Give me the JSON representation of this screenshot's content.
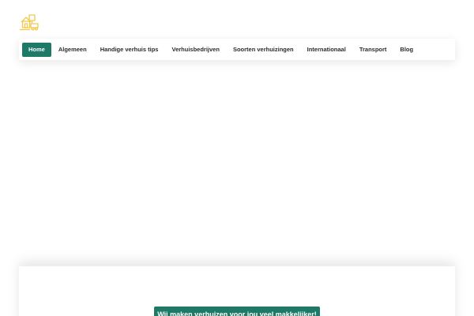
{
  "logo": {
    "icon": "house-moving-icon",
    "color": "#f2c94c"
  },
  "nav": {
    "items": [
      {
        "label": "Home",
        "active": true
      },
      {
        "label": "Algemeen"
      },
      {
        "label": "Handige verhuis tips"
      },
      {
        "label": "Verhuisbedrijven"
      },
      {
        "label": "Soorten verhuizingen"
      },
      {
        "label": "Internationaal"
      },
      {
        "label": "Transport"
      },
      {
        "label": "Blog"
      }
    ],
    "active_color": "#1e7a66"
  },
  "hero": {
    "cta_label": "Wij maken verhuizen voor jou veel makkelijker!"
  }
}
